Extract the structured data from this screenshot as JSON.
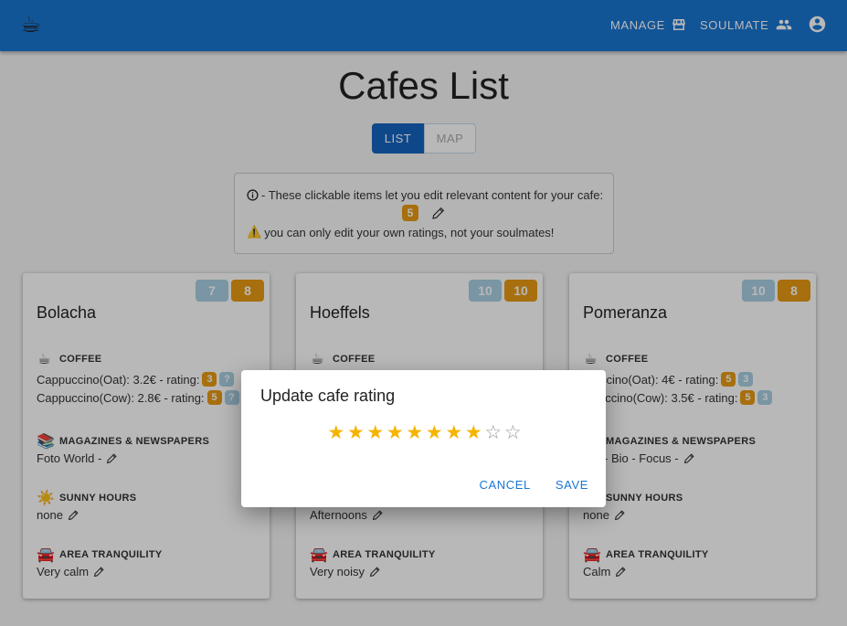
{
  "appbar": {
    "logo_icon": "☕",
    "manage_label": "MANAGE",
    "soulmate_label": "SOULMATE",
    "colors": {
      "bar": "#1976d2"
    }
  },
  "page": {
    "title": "Cafes List",
    "view_toggle": {
      "list_label": "LIST",
      "map_label": "MAP",
      "selected": "LIST"
    }
  },
  "info": {
    "line1": " - These clickable items let you edit relevant content for your cafe:",
    "example_badge": "5",
    "warning_icon": "⚠️",
    "line3": "you can only edit your own ratings, not your soulmates!"
  },
  "cards": [
    {
      "name": "Bolacha",
      "badge_soulmate": "7",
      "badge_mine": "8",
      "coffee_header": "COFFEE",
      "coffee": [
        {
          "text": "Cappuccino(Oat): 3.2€ - rating:",
          "mine": "3",
          "soulmate": "?"
        },
        {
          "text": "Cappuccino(Cow): 2.8€ - rating:",
          "mine": "5",
          "soulmate": "?"
        }
      ],
      "magazines_header": "MAGAZINES & NEWSPAPERS",
      "magazines": "Foto World  -",
      "sunny_header": "SUNNY HOURS",
      "sunny": "none",
      "tranquility_header": "AREA TRANQUILITY",
      "tranquility": "Very calm"
    },
    {
      "name": "Hoeffels",
      "badge_soulmate": "10",
      "badge_mine": "10",
      "coffee_header": "COFFEE",
      "sunny": "Afternoons",
      "tranquility_header": "AREA TRANQUILITY",
      "tranquility": "Very noisy"
    },
    {
      "name": "Pomeranza",
      "badge_soulmate": "10",
      "badge_mine": "8",
      "coffee_header": "COFFEE",
      "coffee": [
        {
          "text": "ccino(Oat): 4€ - rating:",
          "mine": "5",
          "soulmate": "3"
        },
        {
          "text": "uccino(Cow): 3.5€ - rating:",
          "mine": "5",
          "soulmate": "3"
        }
      ],
      "magazines_header": "MAGAZINES & NEWSPAPERS",
      "magazines": "-  Bio  -  Focus  -",
      "sunny_header": "SUNNY HOURS",
      "sunny": "none",
      "tranquility_header": "AREA TRANQUILITY",
      "tranquility": "Calm"
    }
  ],
  "dialog": {
    "title": "Update cafe rating",
    "rating": 8,
    "max_rating": 10,
    "cancel_label": "CANCEL",
    "save_label": "SAVE"
  }
}
